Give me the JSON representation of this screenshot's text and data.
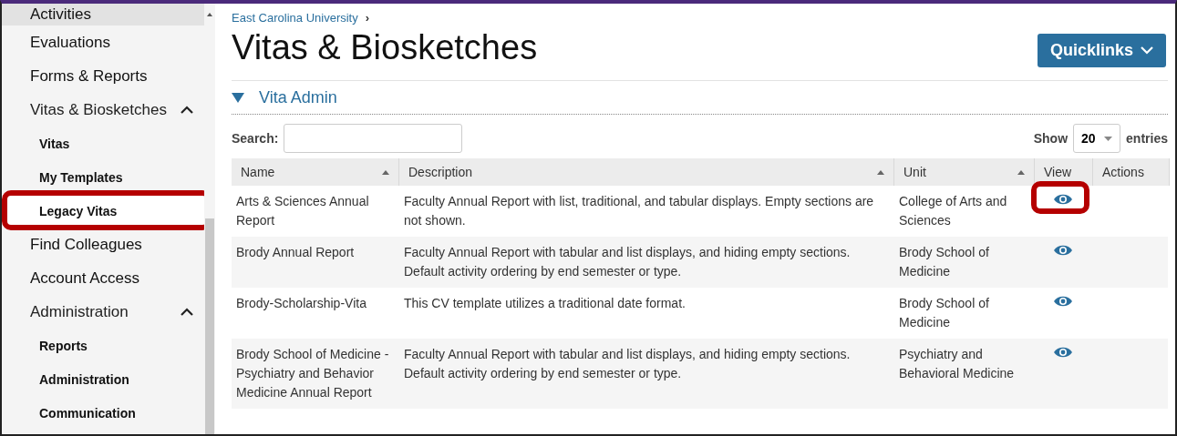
{
  "sidebar": {
    "items": [
      {
        "kind": "link",
        "label": "Activities",
        "selected": true
      },
      {
        "kind": "link",
        "label": "Evaluations",
        "selected": false
      },
      {
        "kind": "link",
        "label": "Forms & Reports",
        "selected": false
      },
      {
        "kind": "group",
        "label": "Vitas & Biosketches",
        "expanded": true,
        "children": [
          {
            "label": "Vitas",
            "selected": false,
            "highlighted": false
          },
          {
            "label": "My Templates",
            "selected": false,
            "highlighted": false
          },
          {
            "label": "Legacy Vitas",
            "selected": true,
            "highlighted": true
          }
        ]
      },
      {
        "kind": "link",
        "label": "Find Colleagues",
        "selected": false
      },
      {
        "kind": "link",
        "label": "Account Access",
        "selected": false
      },
      {
        "kind": "group",
        "label": "Administration",
        "expanded": true,
        "children": [
          {
            "label": "Reports",
            "selected": false,
            "highlighted": false
          },
          {
            "label": "Administration",
            "selected": false,
            "highlighted": false
          },
          {
            "label": "Communication",
            "selected": false,
            "highlighted": false
          }
        ]
      }
    ]
  },
  "breadcrumb": {
    "link": "East Carolina University",
    "separator": "›"
  },
  "page_title": "Vitas & Biosketches",
  "quicklinks": "Quicklinks",
  "section": {
    "title": "Vita Admin",
    "expanded": true
  },
  "search": {
    "label": "Search:"
  },
  "show": {
    "label_before": "Show",
    "value": "20",
    "label_after": "entries"
  },
  "table": {
    "columns": [
      {
        "label": "Name",
        "sortable": true
      },
      {
        "label": "Description",
        "sortable": true
      },
      {
        "label": "Unit",
        "sortable": true
      },
      {
        "label": "View",
        "sortable": false
      },
      {
        "label": "Actions",
        "sortable": false
      }
    ],
    "rows": [
      {
        "name": "Arts & Sciences Annual Report",
        "description": "Faculty Annual Report with list, traditional, and tabular displays.  Empty sections are not shown.",
        "unit": "College of Arts and Sciences",
        "highlighted": true
      },
      {
        "name": "Brody Annual Report",
        "description": "Faculty Annual Report with tabular and list displays, and hiding empty sections. Default activity ordering by end semester or type.",
        "unit": "Brody School of Medicine",
        "highlighted": false
      },
      {
        "name": "Brody-Scholarship-Vita",
        "description": "This CV template utilizes a traditional date format.",
        "unit": "Brody School of Medicine",
        "highlighted": false
      },
      {
        "name": "Brody School of Medicine - Psychiatry and Behavior Medicine Annual Report",
        "description": "Faculty Annual Report with tabular and list displays, and hiding empty sections. Default activity ordering by end semester or type.",
        "unit": "Psychiatry and Behavioral Medicine",
        "highlighted": false
      }
    ]
  }
}
